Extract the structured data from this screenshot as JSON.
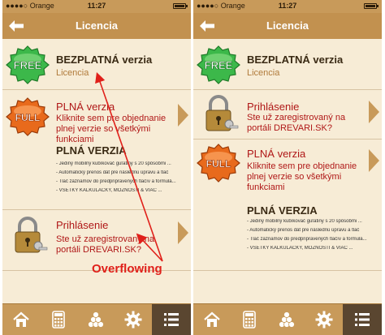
{
  "status": {
    "carrier": "Orange",
    "time": "11:27"
  },
  "nav": {
    "title": "Licencia"
  },
  "left": {
    "free": {
      "badge": "FREE",
      "title": "BEZPLATNÁ verzia",
      "subtitle": "Licencia"
    },
    "full": {
      "badge": "FULL",
      "title": "PLNÁ verzia",
      "subtitle": "Kliknite sem pre objednanie plnej verzie so všetkými funkciami"
    },
    "section_title": "PLNÁ VERZIA",
    "features": [
      "- Jediný mobilný kubíkovač guľatiny s 20 spôsobmi ...",
      "- Automatický prenos dát pre následnú úpravu a tlač",
      "- Tlač záznamov do predpripravených tlačív a formulá...",
      "- VŠETKY KALKULAČKY, MOŽNOSTI & VIAC ..."
    ],
    "login": {
      "title": "Prihlásenie",
      "subtitle": "Ste už zaregistrovaný na portáli DREVARI.SK?"
    }
  },
  "right": {
    "free": {
      "badge": "FREE",
      "title": "BEZPLATNÁ verzia",
      "subtitle": "Licencia"
    },
    "login": {
      "title": "Prihlásenie",
      "subtitle": "Ste už zaregistrovaný na portáli DREVARI.SK?"
    },
    "full": {
      "badge": "FULL",
      "title": "PLNÁ verzia",
      "subtitle": "Kliknite sem pre objednanie plnej verzie so všetkými funkciami"
    },
    "section_title": "PLNÁ VERZIA",
    "features": [
      "- Jediný mobilný kubíkovač guľatiny s 20 spôsobmi ...",
      "- Automatický prenos dát pre následnú úpravu a tlač",
      "- Tlač záznamov do predpripravených tlačív a formulá...",
      "- VŠETKY KALKULAČKY, MOŽNOSTI & VIAC ..."
    ]
  },
  "tabs": [
    "home-icon",
    "calculator-icon",
    "wood-logs-icon",
    "gear-icon",
    "list-icon"
  ],
  "annotation": {
    "label": "Overflowing"
  },
  "colors": {
    "accent": "#c2914f",
    "red_text": "#b01818",
    "annotation": "#e0201a",
    "free_badge": "#3cb84a",
    "full_badge": "#e86a1c"
  }
}
